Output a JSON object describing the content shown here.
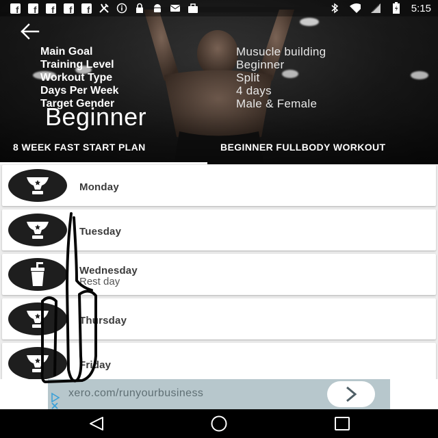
{
  "status_bar": {
    "time": "5:15",
    "left_icons": [
      "facebook-icon",
      "facebook-icon",
      "facebook-icon",
      "facebook-icon",
      "facebook-icon",
      "tools-icon",
      "info-circle-icon",
      "lock-icon",
      "android-icon",
      "mail-icon",
      "briefcase-icon"
    ],
    "right_icons": [
      "bluetooth-icon",
      "wifi-icon",
      "signal-icon",
      "battery-charging-icon"
    ]
  },
  "header": {
    "back_icon": "arrow-left-icon",
    "info": [
      {
        "label": "Main Goal",
        "value": "Musucle building"
      },
      {
        "label": "Training Level",
        "value": "Beginner"
      },
      {
        "label": "Workout Type",
        "value": "Split"
      },
      {
        "label": "Days Per Week",
        "value": "4 days"
      },
      {
        "label": "Target Gender",
        "value": "Male & Female"
      }
    ],
    "level_title": "Beginner"
  },
  "tabs": [
    {
      "label": "8 WEEK FAST START PLAN",
      "selected": true
    },
    {
      "label": "BEGINNER FULLBODY WORKOUT",
      "selected": false
    }
  ],
  "days": [
    {
      "label": "Monday",
      "sub": "",
      "icon": "trophy-icon"
    },
    {
      "label": "Tuesday",
      "sub": "",
      "icon": "trophy-icon"
    },
    {
      "label": "Wednesday",
      "sub": "Rest day",
      "icon": "drink-cup-icon"
    },
    {
      "label": "Thursday",
      "sub": "",
      "icon": "trophy-icon"
    },
    {
      "label": "Friday",
      "sub": "",
      "icon": "trophy-icon"
    }
  ],
  "ad": {
    "text": "xero.com/runyourbusiness",
    "go_icon": "chevron-right-icon",
    "badge_icon": "adchoices-icon"
  },
  "navbar": {
    "icons": [
      "back-triangle-icon",
      "home-circle-icon",
      "recents-square-icon"
    ]
  },
  "colors": {
    "card_bg": "#ffffff",
    "list_bg": "#ececec",
    "avatar_bg": "#1e1e1e",
    "ad_bg": "#b7c7cc",
    "text_dark": "#3a3a3a"
  }
}
